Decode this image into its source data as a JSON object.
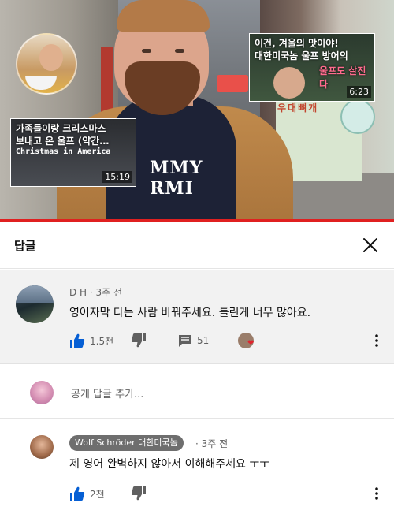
{
  "video": {
    "card_left": {
      "title_line1": "가족들이랑 크리스마스",
      "title_line2": "보내고 온 울프 (약간…",
      "subtitle": "Christmas in America",
      "duration": "15:19"
    },
    "card_right": {
      "title_line1": "이건, 겨울의 맛이야!",
      "title_line2": "대한미국놈 울프 방어의",
      "highlight": "울프도 살진다",
      "duration": "6:23"
    },
    "shirt_text": [
      "MMY",
      "RMI"
    ],
    "shop_sign": "우대뼈개"
  },
  "panel": {
    "title": "답글",
    "close_icon": "close-icon"
  },
  "top_comment": {
    "author": "D H",
    "time": "3주 전",
    "text": "영어자막 다는 사람 바꿔주세요. 틀린게 너무 많아요.",
    "likes": "1.5천",
    "replies": "51"
  },
  "add_reply": {
    "placeholder": "공개 답글 추가..."
  },
  "reply": {
    "author_badge": "Wolf Schröder 대한미국놈",
    "time": "3주 전",
    "text": "제 영어 완벽하지 않아서 이해해주세요 ㅜㅜ",
    "likes": "2천"
  },
  "colors": {
    "accent_blue": "#065fd4",
    "progress_red": "#e02020",
    "heart_red": "#e0242f",
    "badge_gray": "#6e6e6e"
  }
}
